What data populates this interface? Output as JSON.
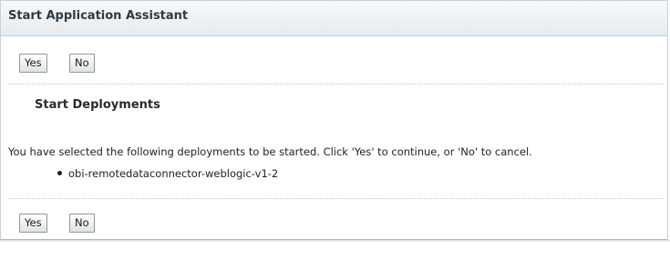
{
  "header": {
    "title": "Start Application Assistant"
  },
  "top_buttons": {
    "yes_label": "Yes",
    "no_label": "No"
  },
  "section": {
    "title": "Start Deployments",
    "message": "You have selected the following deployments to be started. Click 'Yes' to continue, or 'No' to cancel.",
    "deployments": [
      "obi-remotedataconnector-weblogic-v1-2"
    ]
  },
  "bottom_buttons": {
    "yes_label": "Yes",
    "no_label": "No"
  }
}
